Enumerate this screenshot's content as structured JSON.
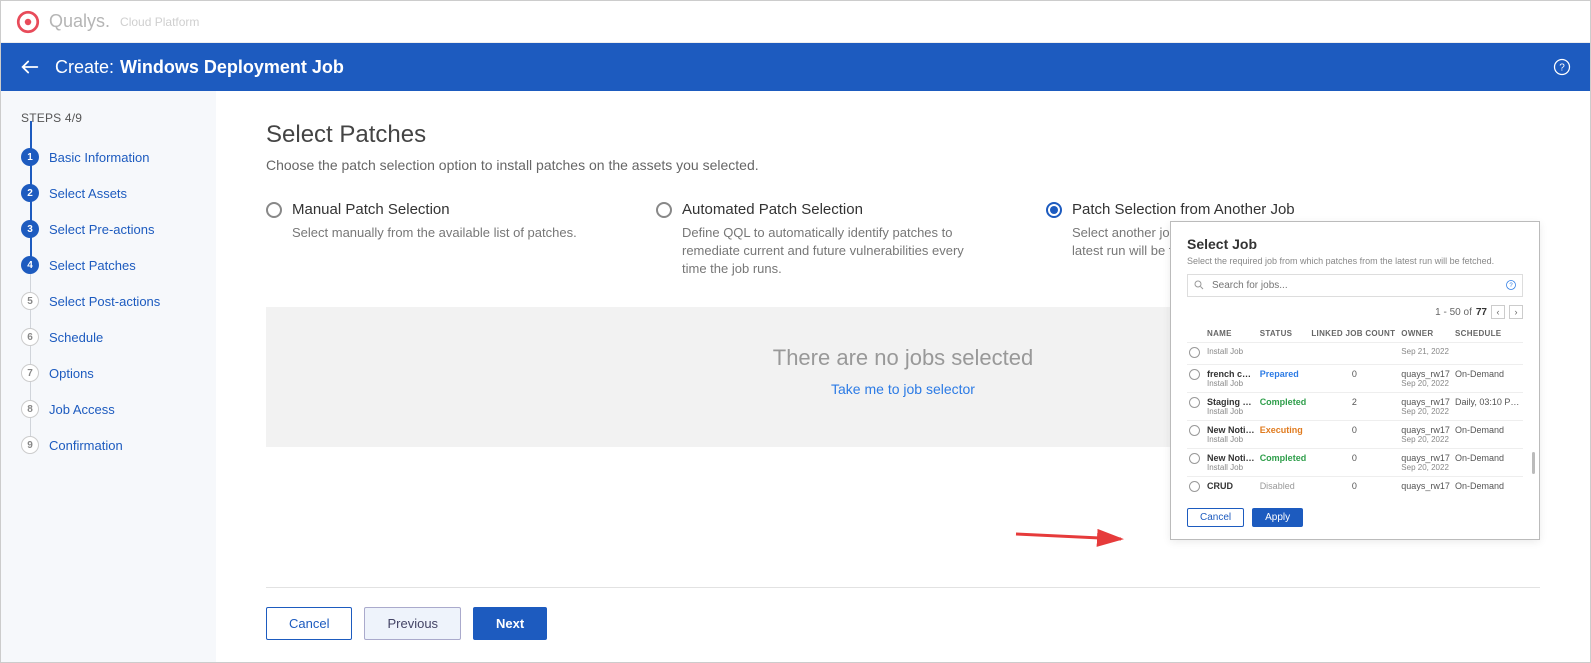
{
  "brand": {
    "name": "Qualys.",
    "sub": "Cloud Platform"
  },
  "bluebar": {
    "create": "Create:",
    "title": "Windows Deployment Job"
  },
  "steps": {
    "header": "STEPS 4/9",
    "items": [
      {
        "num": "1",
        "label": "Basic Information",
        "state": "done"
      },
      {
        "num": "2",
        "label": "Select Assets",
        "state": "done"
      },
      {
        "num": "3",
        "label": "Select Pre-actions",
        "state": "done"
      },
      {
        "num": "4",
        "label": "Select Patches",
        "state": "current"
      },
      {
        "num": "5",
        "label": "Select Post-actions",
        "state": "future"
      },
      {
        "num": "6",
        "label": "Schedule",
        "state": "future"
      },
      {
        "num": "7",
        "label": "Options",
        "state": "future"
      },
      {
        "num": "8",
        "label": "Job Access",
        "state": "future"
      },
      {
        "num": "9",
        "label": "Confirmation",
        "state": "future"
      }
    ]
  },
  "page": {
    "title": "Select Patches",
    "sub": "Choose the patch selection option to install patches on the assets you selected."
  },
  "radios": [
    {
      "title": "Manual Patch Selection",
      "desc": "Select manually from the available list of patches.",
      "selected": false
    },
    {
      "title": "Automated Patch Selection",
      "desc": "Define QQL to automatically identify patches to remediate current and future vulnerabilities every time the job runs.",
      "selected": false
    },
    {
      "title": "Patch Selection from Another Job",
      "desc": "Select another job from which patches from the latest run will be fetched.",
      "selected": true
    }
  ],
  "empty": {
    "title": "There are no jobs selected",
    "link": "Take me to job selector"
  },
  "footer": {
    "cancel": "Cancel",
    "previous": "Previous",
    "next": "Next"
  },
  "popup": {
    "title": "Select Job",
    "sub": "Select the required job from which patches from the latest run will be fetched.",
    "search_placeholder": "Search for jobs...",
    "pager": {
      "range": "1 - 50 of",
      "total": "77"
    },
    "columns": {
      "name": "NAME",
      "status": "STATUS",
      "linked": "LINKED JOB COUNT",
      "owner": "OWNER",
      "schedule": "SCHEDULE"
    },
    "rows": [
      {
        "name": "",
        "type": "Install Job",
        "status": "",
        "status_cls": "",
        "linked": "",
        "owner": "",
        "date": "Sep 21, 2022",
        "schedule": ""
      },
      {
        "name": "french c…",
        "type": "Install Job",
        "status": "Prepared",
        "status_cls": "st-prep",
        "linked": "0",
        "owner": "quays_rw17",
        "date": "Sep 20, 2022",
        "schedule": "On-Demand"
      },
      {
        "name": "Staging …",
        "type": "Install Job",
        "status": "Completed",
        "status_cls": "st-comp",
        "linked": "2",
        "owner": "quays_rw17",
        "date": "Sep 20, 2022",
        "schedule": "Daily, 03:10 P…"
      },
      {
        "name": "New Noti…",
        "type": "Install Job",
        "status": "Executing",
        "status_cls": "st-exec",
        "linked": "0",
        "owner": "quays_rw17",
        "date": "Sep 20, 2022",
        "schedule": "On-Demand"
      },
      {
        "name": "New Noti…",
        "type": "Install Job",
        "status": "Completed",
        "status_cls": "st-comp",
        "linked": "0",
        "owner": "quays_rw17",
        "date": "Sep 20, 2022",
        "schedule": "On-Demand"
      },
      {
        "name": "CRUD",
        "type": "",
        "status": "Disabled",
        "status_cls": "st-dis",
        "linked": "0",
        "owner": "quays_rw17",
        "date": "",
        "schedule": "On-Demand"
      }
    ],
    "footer": {
      "cancel": "Cancel",
      "apply": "Apply"
    }
  }
}
